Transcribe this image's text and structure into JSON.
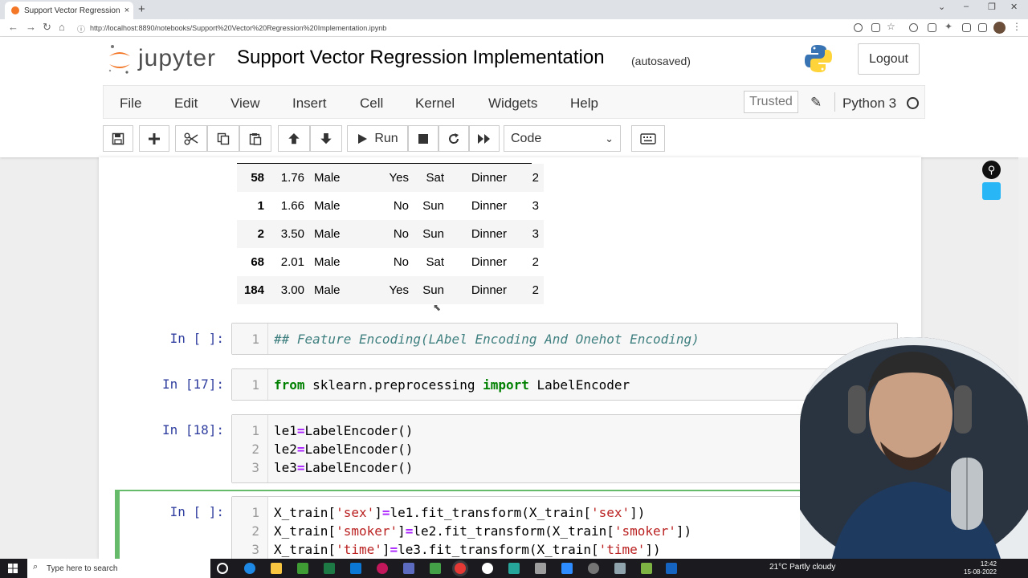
{
  "browser": {
    "tab_title": "Support Vector Regression Imple",
    "tab_close": "×",
    "new_tab": "+",
    "url": "http://localhost:8890/notebooks/Support%20Vector%20Regression%20Implementation.ipynb"
  },
  "header": {
    "logo_text": "jupyter",
    "notebook_title": "Support Vector Regression Implementation",
    "autosave_status": "(autosaved)",
    "logout_label": "Logout"
  },
  "menu": {
    "items": [
      "File",
      "Edit",
      "View",
      "Insert",
      "Cell",
      "Kernel",
      "Widgets",
      "Help"
    ],
    "trusted_label": "Trusted",
    "kernel_name": "Python 3"
  },
  "toolbar": {
    "run_label": "Run",
    "cell_type": "Code"
  },
  "dataframe": {
    "rows": [
      [
        "58",
        "1.76",
        "Male",
        "Yes",
        "Sat",
        "Dinner",
        "2"
      ],
      [
        "1",
        "1.66",
        "Male",
        "No",
        "Sun",
        "Dinner",
        "3"
      ],
      [
        "2",
        "3.50",
        "Male",
        "No",
        "Sun",
        "Dinner",
        "3"
      ],
      [
        "68",
        "2.01",
        "Male",
        "No",
        "Sat",
        "Dinner",
        "2"
      ],
      [
        "184",
        "3.00",
        "Male",
        "Yes",
        "Sun",
        "Dinner",
        "2"
      ]
    ]
  },
  "cells": [
    {
      "prompt": "In [ ]:",
      "lines": [
        "## Feature Encoding(LAbel Encoding And Onehot Encoding)"
      ]
    },
    {
      "prompt": "In [17]:",
      "lines": [
        "from sklearn.preprocessing import LabelEncoder"
      ]
    },
    {
      "prompt": "In [18]:",
      "lines": [
        "le1=LabelEncoder()",
        "le2=LabelEncoder()",
        "le3=LabelEncoder()"
      ]
    },
    {
      "prompt": "In [ ]:",
      "lines": [
        "X_train['sex']=le1.fit_transform(X_train['sex'])",
        "X_train['smoker']=le2.fit_transform(X_train['smoker'])",
        "X_train['time']=le3.fit_transform(X_train['time'])"
      ]
    }
  ],
  "taskbar": {
    "search_placeholder": "Type here to search",
    "weather": "21°C  Partly cloudy",
    "time": "12:42",
    "date": "15-08-2022"
  },
  "colors": {
    "jupyter_orange": "#f37726",
    "prompt_blue": "#303f9f",
    "selected_green": "#66bb6a"
  }
}
